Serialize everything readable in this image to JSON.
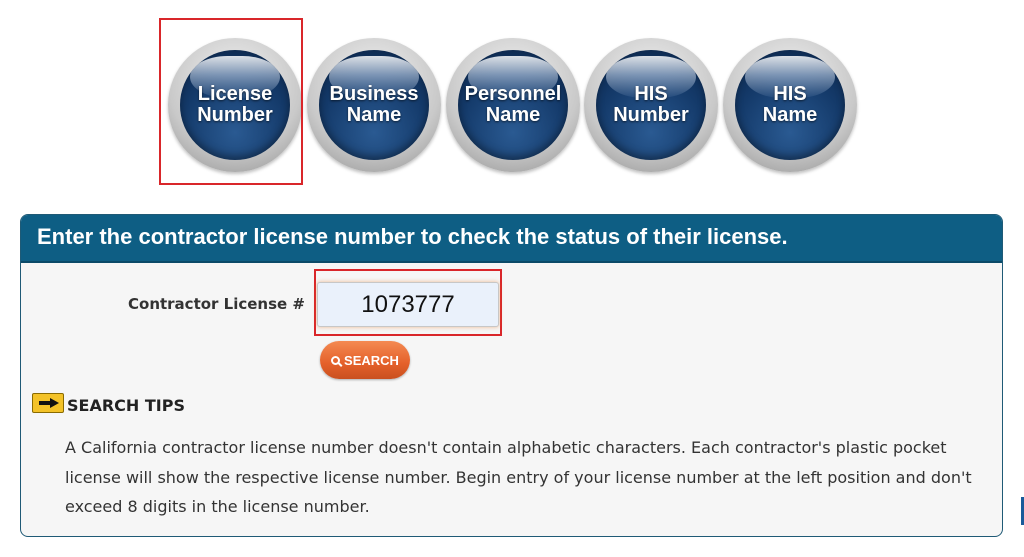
{
  "search_modes": [
    {
      "id": "license-number",
      "line1": "License",
      "line2": "Number",
      "selected": true
    },
    {
      "id": "business-name",
      "line1": "Business",
      "line2": "Name",
      "selected": false
    },
    {
      "id": "personnel-name",
      "line1": "Personnel",
      "line2": "Name",
      "selected": false
    },
    {
      "id": "his-number",
      "line1": "HIS",
      "line2": "Number",
      "selected": false
    },
    {
      "id": "his-name",
      "line1": "HIS",
      "line2": "Name",
      "selected": false
    }
  ],
  "panel": {
    "heading": "Enter the contractor license number to check the status of their license.",
    "field_label": "Contractor License #",
    "license_value": "1073777",
    "search_label": "SEARCH"
  },
  "tips": {
    "icon": "arrow-right-icon",
    "title": "SEARCH TIPS",
    "body": "A California contractor license number doesn't contain alphabetic characters. Each contractor's plastic pocket license will show the respective license number. Begin entry of your license number at the left position and don't exceed 8 digits in the license number."
  },
  "colors": {
    "header_bg": "#0e5e84",
    "button_orange": "#e4602a",
    "highlight_red": "#d9262a",
    "tips_yellow": "#f3c228"
  }
}
